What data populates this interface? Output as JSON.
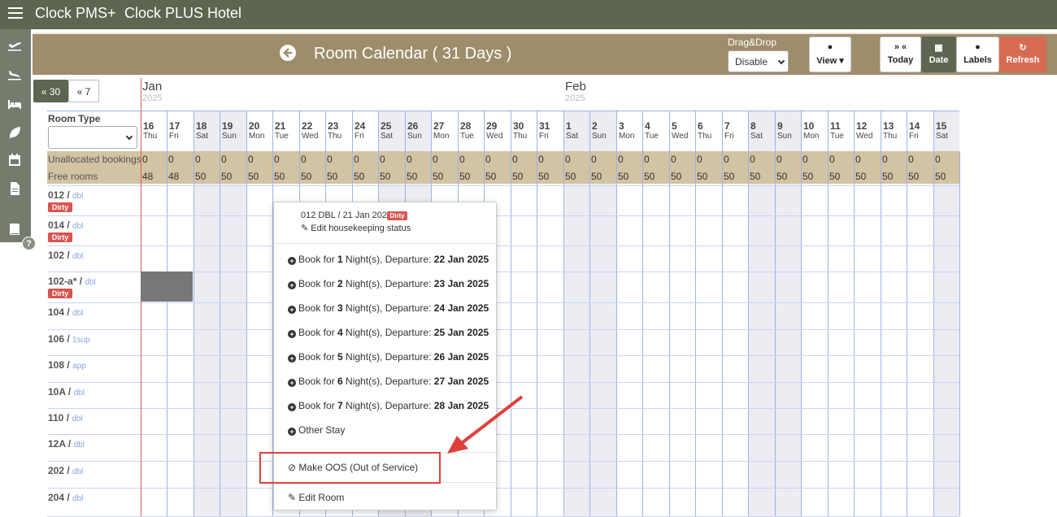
{
  "topbar": {
    "brand": "Clock PMS+",
    "hotel": "Clock PLUS Hotel"
  },
  "header": {
    "title": "Room Calendar ( 31 Days )",
    "dragdrop_label": "Drag&Drop",
    "dragdrop_value": "Disable",
    "buttons": {
      "view": "View",
      "today_icon": "» «",
      "today": "Today",
      "date": "Date",
      "labels": "Labels",
      "refresh": "Refresh"
    }
  },
  "nav": {
    "back30": "« 30",
    "back7": "« 7"
  },
  "months": [
    {
      "name": "Jan",
      "year": "2025"
    },
    {
      "name": "Feb",
      "year": "2025"
    }
  ],
  "room_type_label": "Room Type",
  "days": [
    {
      "d": "16",
      "w": "Thu"
    },
    {
      "d": "17",
      "w": "Fri"
    },
    {
      "d": "18",
      "w": "Sat"
    },
    {
      "d": "19",
      "w": "Sun"
    },
    {
      "d": "20",
      "w": "Mon"
    },
    {
      "d": "21",
      "w": "Tue"
    },
    {
      "d": "22",
      "w": "Wed"
    },
    {
      "d": "23",
      "w": "Thu"
    },
    {
      "d": "24",
      "w": "Fri"
    },
    {
      "d": "25",
      "w": "Sat"
    },
    {
      "d": "26",
      "w": "Sun"
    },
    {
      "d": "27",
      "w": "Mon"
    },
    {
      "d": "28",
      "w": "Tue"
    },
    {
      "d": "29",
      "w": "Wed"
    },
    {
      "d": "30",
      "w": "Thu"
    },
    {
      "d": "31",
      "w": "Fri"
    },
    {
      "d": "1",
      "w": "Sat"
    },
    {
      "d": "2",
      "w": "Sun"
    },
    {
      "d": "3",
      "w": "Mon"
    },
    {
      "d": "4",
      "w": "Tue"
    },
    {
      "d": "5",
      "w": "Wed"
    },
    {
      "d": "6",
      "w": "Thu"
    },
    {
      "d": "7",
      "w": "Fri"
    },
    {
      "d": "8",
      "w": "Sat"
    },
    {
      "d": "9",
      "w": "Sun"
    },
    {
      "d": "10",
      "w": "Mon"
    },
    {
      "d": "11",
      "w": "Tue"
    },
    {
      "d": "12",
      "w": "Wed"
    },
    {
      "d": "13",
      "w": "Thu"
    },
    {
      "d": "14",
      "w": "Fri"
    },
    {
      "d": "15",
      "w": "Sat"
    }
  ],
  "unallocated": {
    "label": "Unallocated bookings",
    "values": [
      "0",
      "0",
      "0",
      "0",
      "0",
      "0",
      "0",
      "0",
      "0",
      "0",
      "0",
      "0",
      "0",
      "0",
      "0",
      "0",
      "0",
      "0",
      "0",
      "0",
      "0",
      "0",
      "0",
      "0",
      "0",
      "0",
      "0",
      "0",
      "0",
      "0",
      "0"
    ]
  },
  "free": {
    "label": "Free rooms",
    "values": [
      "48",
      "48",
      "50",
      "50",
      "50",
      "50",
      "50",
      "50",
      "50",
      "50",
      "50",
      "50",
      "50",
      "50",
      "50",
      "50",
      "50",
      "50",
      "50",
      "50",
      "50",
      "50",
      "50",
      "50",
      "50",
      "50",
      "50",
      "50",
      "50",
      "50",
      "50"
    ]
  },
  "rooms": [
    {
      "name": "012",
      "type": "dbl",
      "dirty": "Dirty"
    },
    {
      "name": "014",
      "type": "dbl",
      "dirty": "Dirty"
    },
    {
      "name": "102",
      "type": "dbl",
      "dirty": ""
    },
    {
      "name": "102-a*",
      "type": "dbl",
      "dirty": "Dirty"
    },
    {
      "name": "104",
      "type": "dbl",
      "dirty": ""
    },
    {
      "name": "106",
      "type": "1sup",
      "dirty": ""
    },
    {
      "name": "108",
      "type": "app",
      "dirty": ""
    },
    {
      "name": "10A",
      "type": "dbl",
      "dirty": ""
    },
    {
      "name": "110",
      "type": "dbl",
      "dirty": ""
    },
    {
      "name": "12A",
      "type": "dbl",
      "dirty": ""
    },
    {
      "name": "202",
      "type": "dbl",
      "dirty": ""
    },
    {
      "name": "204",
      "type": "dbl",
      "dirty": ""
    }
  ],
  "popup": {
    "title": "012 DBL / 21 Jan 2025",
    "dirty": "Dirty",
    "edit_housekeeping": "Edit housekeeping status",
    "book_prefix": "Book for",
    "book_mid": "Night(s), Departure:",
    "bookings": [
      {
        "n": "1",
        "date": "22 Jan 2025"
      },
      {
        "n": "2",
        "date": "23 Jan 2025"
      },
      {
        "n": "3",
        "date": "24 Jan 2025"
      },
      {
        "n": "4",
        "date": "25 Jan 2025"
      },
      {
        "n": "5",
        "date": "26 Jan 2025"
      },
      {
        "n": "6",
        "date": "27 Jan 2025"
      },
      {
        "n": "7",
        "date": "28 Jan 2025"
      }
    ],
    "other_stay": "Other Stay",
    "make_oos": "Make OOS (Out of Service)",
    "edit_room": "Edit Room"
  },
  "colors": {
    "topbar": "#5c6650",
    "header": "#9e8d6b",
    "summary": "#d2c3a3",
    "dirty": "#d9534f",
    "refresh": "#d76b52",
    "annotation": "#e0403a"
  }
}
